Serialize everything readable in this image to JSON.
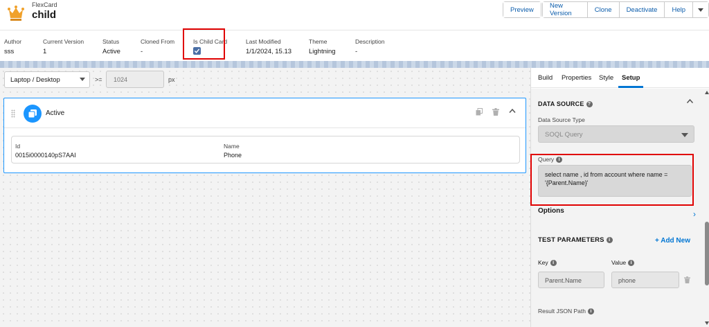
{
  "header": {
    "subtitle": "FlexCard",
    "title": "child",
    "buttons": [
      "Preview",
      "New Version",
      "Clone",
      "Deactivate",
      "Help"
    ]
  },
  "meta": [
    {
      "label": "Author",
      "value": "sss"
    },
    {
      "label": "Current Version",
      "value": "1"
    },
    {
      "label": "Status",
      "value": "Active"
    },
    {
      "label": "Cloned From",
      "value": "-"
    },
    {
      "label": "Is Child Card",
      "value": ""
    },
    {
      "label": "Last Modified",
      "value": "1/1/2024, 15.13"
    },
    {
      "label": "Theme",
      "value": "Lightning"
    },
    {
      "label": "Description",
      "value": "-"
    }
  ],
  "canvas": {
    "device": "Laptop / Desktop",
    "gte": ">=",
    "width_value": "1024",
    "unit": "px",
    "state": {
      "name": "Active",
      "fields": [
        {
          "label": "Id",
          "value": "0015i0000140pS7AAI"
        },
        {
          "label": "Name",
          "value": "Phone"
        }
      ]
    }
  },
  "panel": {
    "tabs": [
      "Build",
      "Properties",
      "Style",
      "Setup"
    ],
    "active_tab": "Setup",
    "data_source_title": "DATA SOURCE",
    "data_source_type_label": "Data Source Type",
    "data_source_type_value": "SOQL Query",
    "query_label": "Query",
    "query_value": "select name , id from account where name = '{Parent.Name}'",
    "options_label": "Options",
    "test_params_title": "TEST PARAMETERS",
    "add_new_label": "+ Add New",
    "key_label": "Key",
    "value_label": "Value",
    "key_value": "Parent.Name",
    "value_value": "phone",
    "result_json_label": "Result JSON Path"
  },
  "colors": {
    "accent": "#0176d3",
    "highlight": "#e00000",
    "state_icon": "#1b96ff"
  }
}
